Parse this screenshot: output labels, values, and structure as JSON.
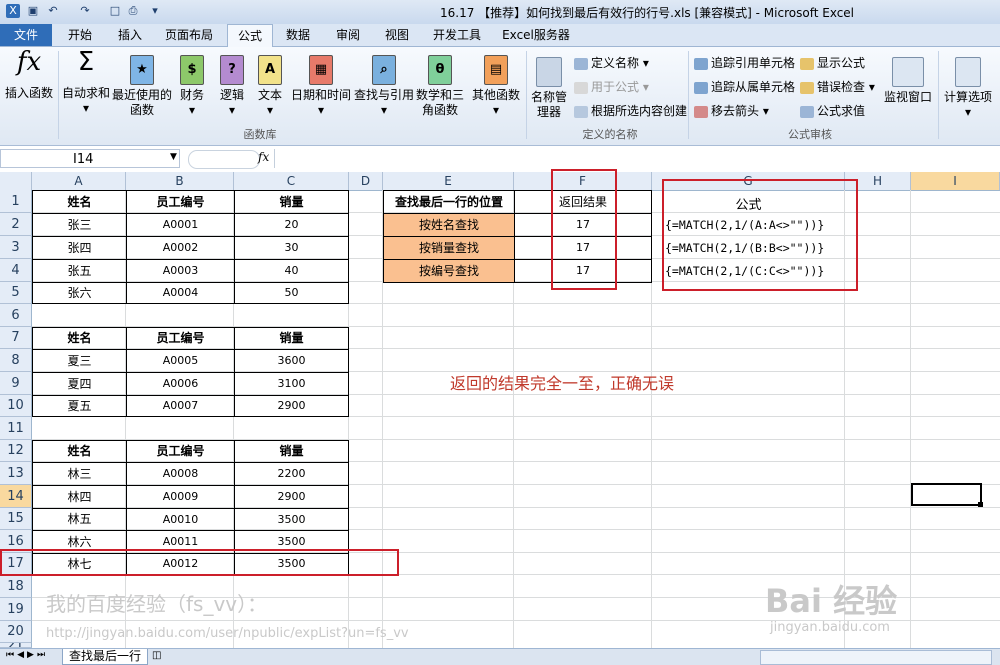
{
  "window": {
    "title": "16.17 【推荐】如何找到最后有效行的行号.xls [兼容模式] - Microsoft Excel"
  },
  "ribbon_tabs": [
    "文件",
    "开始",
    "插入",
    "页面布局",
    "公式",
    "数据",
    "审阅",
    "视图",
    "开发工具",
    "Excel服务器"
  ],
  "ribbon": {
    "insert_function": "插入函数",
    "autosum": "自动求和",
    "recent": "最近使用的函数",
    "financial": "财务",
    "logical": "逻辑",
    "text": "文本",
    "datetime": "日期和时间",
    "lookup": "查找与引用",
    "math": "数学和三角函数",
    "more": "其他函数",
    "group_library": "函数库",
    "name_manager": "名称管理器",
    "define_name": "定义名称",
    "use_in_formula": "用于公式",
    "create_from_selection": "根据所选内容创建",
    "group_names": "定义的名称",
    "trace_precedents": "追踪引用单元格",
    "trace_dependents": "追踪从属单元格",
    "remove_arrows": "移去箭头",
    "show_formulas": "显示公式",
    "error_checking": "错误检查",
    "evaluate_formula": "公式求值",
    "watch_window": "监视窗口",
    "group_auditing": "公式审核",
    "calc_options": "计算选项"
  },
  "formula_bar": {
    "name_box": "I14",
    "fx": "fx",
    "content": ""
  },
  "columns": [
    "A",
    "B",
    "C",
    "D",
    "E",
    "F",
    "G",
    "H",
    "I"
  ],
  "rows": [
    "1",
    "2",
    "3",
    "4",
    "5",
    "6",
    "7",
    "8",
    "9",
    "10",
    "11",
    "12",
    "13",
    "14",
    "15",
    "16",
    "17",
    "18",
    "19",
    "20",
    "21"
  ],
  "table1": {
    "header": [
      "姓名",
      "员工编号",
      "销量"
    ],
    "rows": [
      [
        "张三",
        "A0001",
        "20"
      ],
      [
        "张四",
        "A0002",
        "30"
      ],
      [
        "张五",
        "A0003",
        "40"
      ],
      [
        "张六",
        "A0004",
        "50"
      ]
    ]
  },
  "table2": {
    "header": [
      "姓名",
      "员工编号",
      "销量"
    ],
    "rows": [
      [
        "夏三",
        "A0005",
        "3600"
      ],
      [
        "夏四",
        "A0006",
        "3100"
      ],
      [
        "夏五",
        "A0007",
        "2900"
      ]
    ]
  },
  "table3": {
    "header": [
      "姓名",
      "员工编号",
      "销量"
    ],
    "rows": [
      [
        "林三",
        "A0008",
        "2200"
      ],
      [
        "林四",
        "A0009",
        "2900"
      ],
      [
        "林五",
        "A0010",
        "3500"
      ],
      [
        "林六",
        "A0011",
        "3500"
      ],
      [
        "林七",
        "A0012",
        "3500"
      ]
    ]
  },
  "lookup": {
    "header_e": "查找最后一行的位置",
    "header_f": "返回结果",
    "header_g": "公式",
    "rows": [
      {
        "label": "按姓名查找",
        "result": "17",
        "formula": "{=MATCH(2,1/(A:A<>\"\"))}"
      },
      {
        "label": "按销量查找",
        "result": "17",
        "formula": "{=MATCH(2,1/(B:B<>\"\"))}"
      },
      {
        "label": "按编号查找",
        "result": "17",
        "formula": "{=MATCH(2,1/(C:C<>\"\"))}"
      }
    ]
  },
  "note": "返回的结果完全一至，正确无误",
  "sheet_tab": "查找最后一行",
  "watermark": {
    "line1": "我的百度经验（fs_vv）：",
    "line2": "http://jingyan.baidu.com/user/npublic/expList?un=fs_vv",
    "logo": "Bai 经验",
    "logo_url": "jingyan.baidu.com"
  },
  "colors": {
    "accent_red": "#cc1f2a",
    "orange_fill": "#fac090",
    "file_tab": "#2f6db8"
  }
}
